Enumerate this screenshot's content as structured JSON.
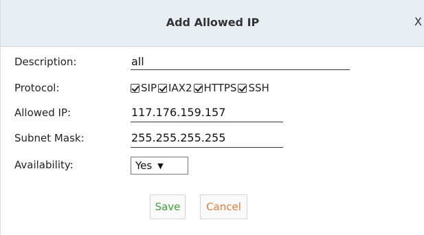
{
  "dialog": {
    "title": "Add Allowed IP",
    "close_label": "X"
  },
  "form": {
    "description": {
      "label": "Description:",
      "value": "all"
    },
    "protocol": {
      "label": "Protocol:",
      "options": [
        {
          "name": "SIP",
          "checked": true
        },
        {
          "name": "IAX2",
          "checked": true
        },
        {
          "name": "HTTPS",
          "checked": true
        },
        {
          "name": "SSH",
          "checked": true
        }
      ]
    },
    "allowed_ip": {
      "label": "Allowed IP:",
      "value": "117.176.159.157"
    },
    "subnet_mask": {
      "label": "Subnet Mask:",
      "value": "255.255.255.255"
    },
    "availability": {
      "label": "Availability:",
      "selected": "Yes"
    }
  },
  "buttons": {
    "save_label": "Save",
    "cancel_label": "Cancel"
  },
  "colors": {
    "header_bg": "#e7eef4",
    "save_text": "#3aa23a",
    "cancel_text": "#e07b39"
  },
  "icons": {
    "close": "close-icon",
    "dropdown": "chevron-down-icon",
    "checkbox": "checkbox-checked-icon"
  }
}
